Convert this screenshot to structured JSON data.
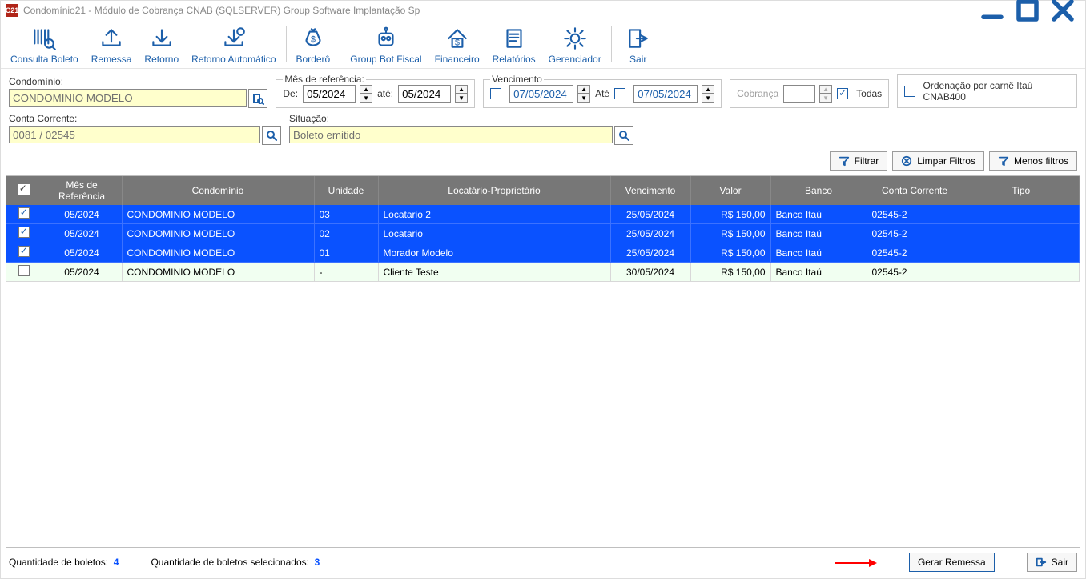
{
  "window": {
    "title": "Condomínio21 - Módulo de Cobrança CNAB (SQLSERVER)  Group Software Implantação Sp",
    "app_badge": "C21"
  },
  "toolbar": {
    "consulta_boleto": "Consulta Boleto",
    "remessa": "Remessa",
    "retorno": "Retorno",
    "retorno_automatico": "Retorno Automático",
    "bordero": "Borderô",
    "group_bot_fiscal": "Group Bot Fiscal",
    "financeiro": "Financeiro",
    "relatorios": "Relatórios",
    "gerenciador": "Gerenciador",
    "sair": "Sair"
  },
  "filters": {
    "condominio_label": "Condomínio:",
    "condominio_value": "CONDOMINIO MODELO",
    "mes_ref_legend": "Mês de referência:",
    "mes_de_label": "De:",
    "mes_de_value": "05/2024",
    "mes_ate_label": "até:",
    "mes_ate_value": "05/2024",
    "venc_legend": "Vencimento",
    "venc_de_value": "07/05/2024",
    "venc_ate_label": "Até",
    "venc_ate_value": "07/05/2024",
    "cobranca_label": "Cobrança",
    "todas_label": "Todas",
    "ordenacao_label": "Ordenação por carnê Itaú CNAB400",
    "conta_label": "Conta Corrente:",
    "conta_value": "0081 / 02545",
    "situacao_label": "Situação:",
    "situacao_value": "Boleto emitido",
    "filtrar": "Filtrar",
    "limpar": "Limpar Filtros",
    "menos": "Menos filtros"
  },
  "grid": {
    "headers": {
      "mes_ref": "Mês de Referência",
      "condominio": "Condomínio",
      "unidade": "Unidade",
      "locatario": "Locatário-Proprietário",
      "vencimento": "Vencimento",
      "valor": "Valor",
      "banco": "Banco",
      "conta": "Conta Corrente",
      "tipo": "Tipo"
    },
    "rows": [
      {
        "checked": true,
        "mes": "05/2024",
        "cond": "CONDOMINIO MODELO",
        "uni": "03",
        "loc": "Locatario 2",
        "venc": "25/05/2024",
        "valor": "R$ 150,00",
        "banco": "Banco Itaú",
        "conta": "02545-2",
        "tipo": "",
        "selected": true
      },
      {
        "checked": true,
        "mes": "05/2024",
        "cond": "CONDOMINIO MODELO",
        "uni": "02",
        "loc": "Locatario",
        "venc": "25/05/2024",
        "valor": "R$ 150,00",
        "banco": "Banco Itaú",
        "conta": "02545-2",
        "tipo": "",
        "selected": true
      },
      {
        "checked": true,
        "mes": "05/2024",
        "cond": "CONDOMINIO MODELO",
        "uni": "01",
        "loc": "Morador Modelo",
        "venc": "25/05/2024",
        "valor": "R$ 150,00",
        "banco": "Banco Itaú",
        "conta": "02545-2",
        "tipo": "",
        "selected": true
      },
      {
        "checked": false,
        "mes": "05/2024",
        "cond": "CONDOMINIO MODELO",
        "uni": "-",
        "loc": "Cliente Teste",
        "venc": "30/05/2024",
        "valor": "R$ 150,00",
        "banco": "Banco Itaú",
        "conta": "02545-2",
        "tipo": "",
        "selected": false
      }
    ]
  },
  "footer": {
    "qt_boletos_label": "Quantidade de boletos:",
    "qt_boletos_value": "4",
    "qt_sel_label": "Quantidade de boletos selecionados:",
    "qt_sel_value": "3",
    "gerar_remessa": "Gerar Remessa",
    "sair": "Sair"
  }
}
